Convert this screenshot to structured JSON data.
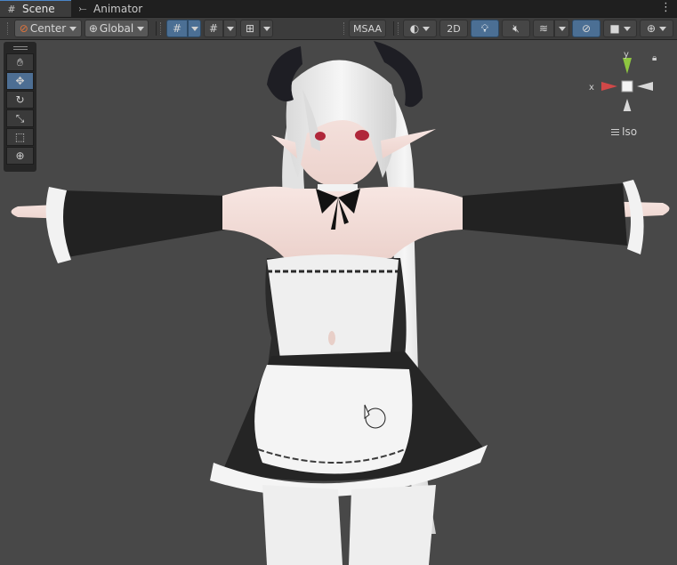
{
  "tabs": [
    {
      "label": "Scene",
      "icon": "grid-icon"
    },
    {
      "label": "Animator",
      "icon": "animator-icon"
    }
  ],
  "toolbar": {
    "pivot_mode": "Center",
    "pivot_rotation": "Global",
    "msaa_label": "MSAA",
    "view_2d_label": "2D"
  },
  "gizmo": {
    "axis_x": "x",
    "axis_y": "y",
    "projection": "Iso"
  },
  "colors": {
    "accent": "#4b6f94",
    "axis_x": "#d04848",
    "axis_y": "#8ec640",
    "viewport": "#484848"
  }
}
